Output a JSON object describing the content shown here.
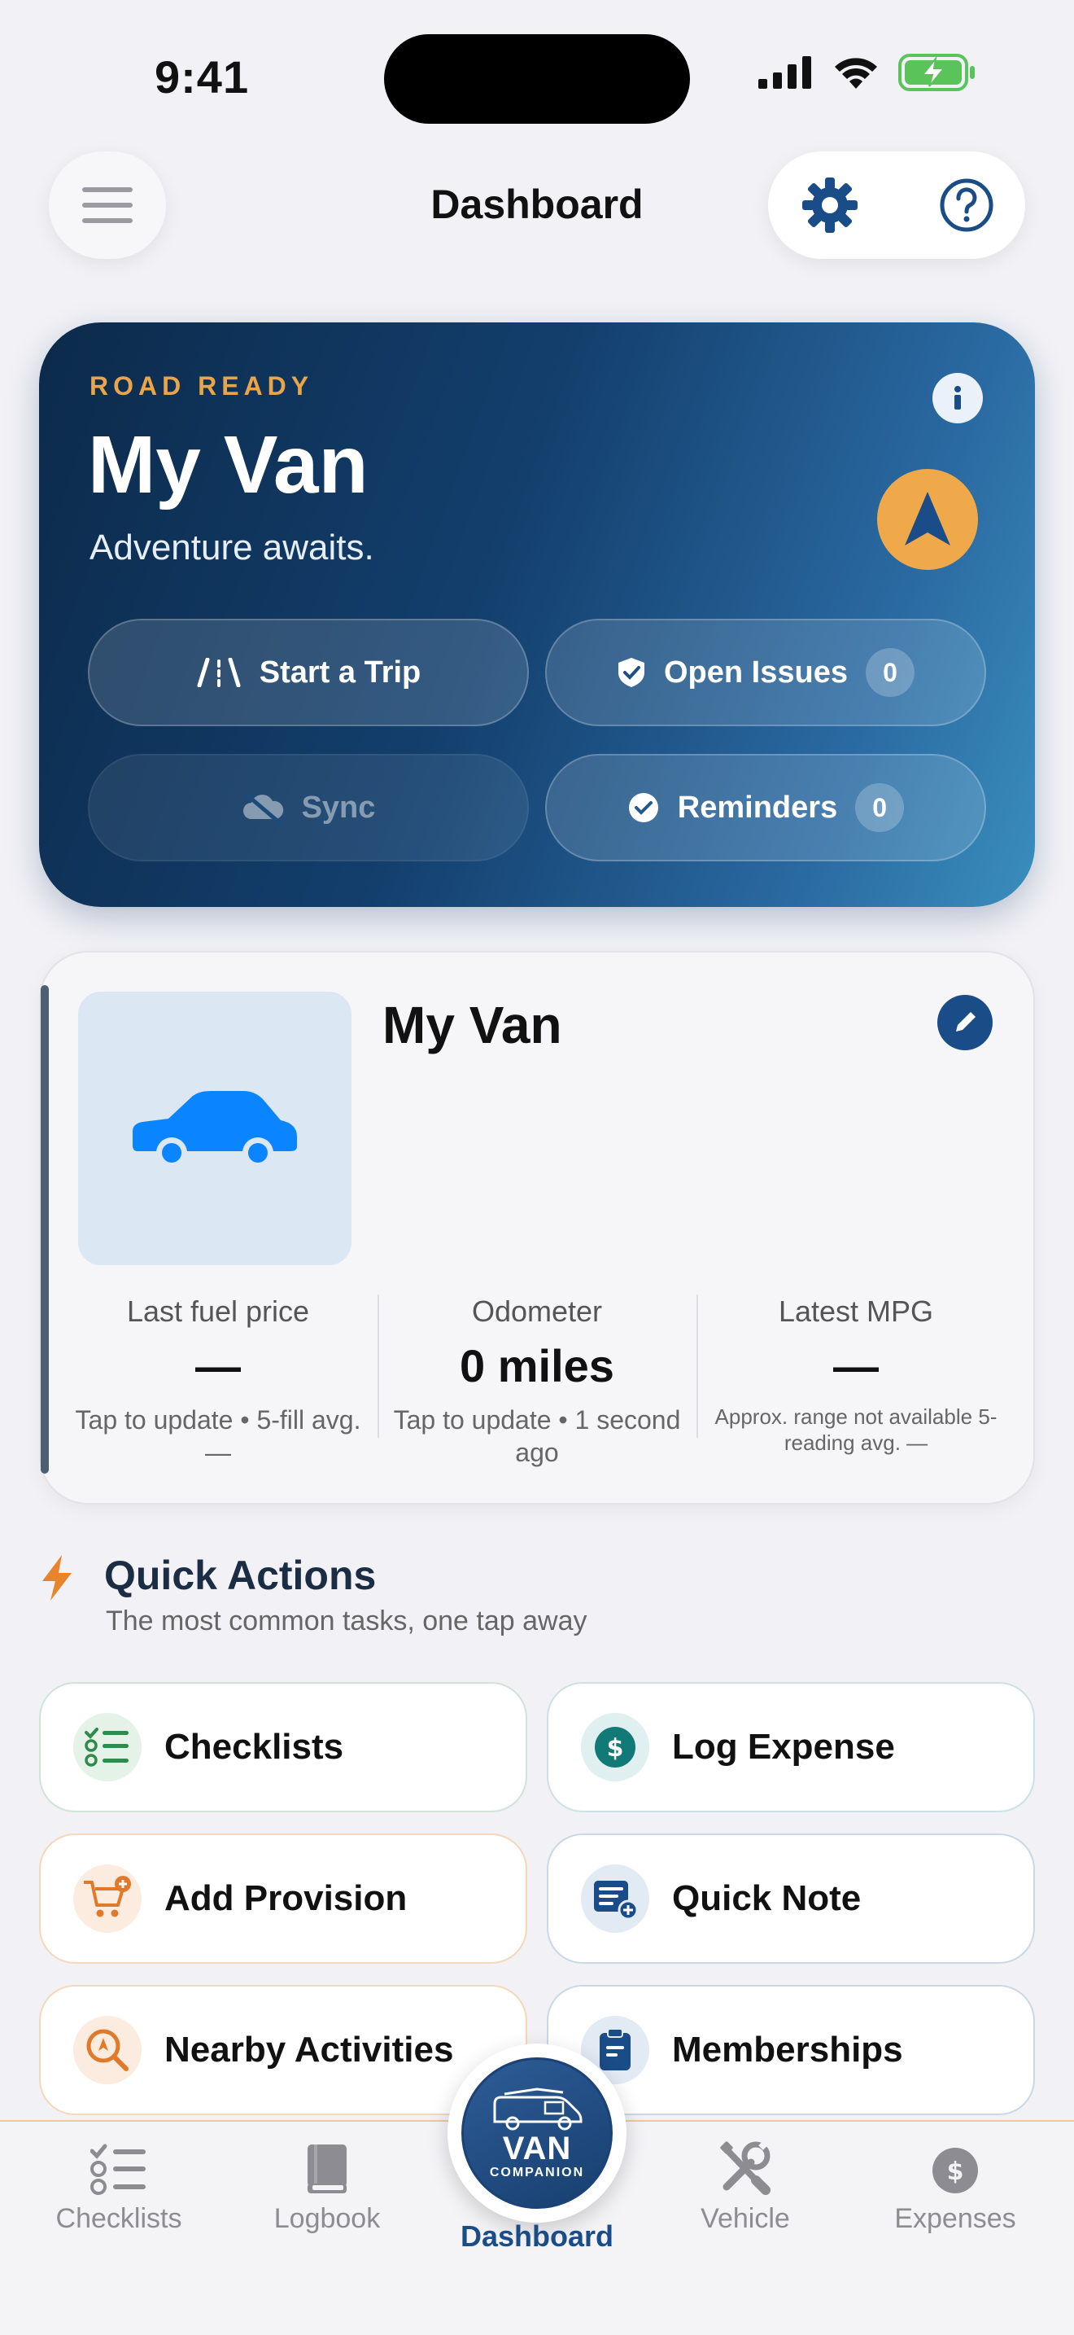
{
  "status": {
    "time": "9:41"
  },
  "header": {
    "title": "Dashboard"
  },
  "hero": {
    "eyebrow": "ROAD READY",
    "title": "My Van",
    "subtitle": "Adventure awaits.",
    "buttons": {
      "start_trip": "Start a Trip",
      "open_issues": "Open Issues",
      "open_issues_count": "0",
      "sync": "Sync",
      "reminders": "Reminders",
      "reminders_count": "0"
    }
  },
  "vehicle": {
    "name": "My Van",
    "stats": [
      {
        "label": "Last fuel price",
        "value": "—",
        "note": "Tap to update • 5-fill avg. —"
      },
      {
        "label": "Odometer",
        "value": "0 miles",
        "note": "Tap to update • 1 second ago"
      },
      {
        "label": "Latest MPG",
        "value": "—",
        "note": "Approx. range not available 5-reading avg. —"
      }
    ]
  },
  "quick_actions": {
    "title": "Quick Actions",
    "subtitle": "The most common tasks, one tap away",
    "items": [
      {
        "label": "Checklists",
        "icon": "checklist-icon"
      },
      {
        "label": "Log Expense",
        "icon": "dollar-icon"
      },
      {
        "label": "Add Provision",
        "icon": "cart-add-icon"
      },
      {
        "label": "Quick Note",
        "icon": "note-add-icon"
      },
      {
        "label": "Nearby Activities",
        "icon": "compass-search-icon"
      },
      {
        "label": "Memberships",
        "icon": "clipboard-icon"
      }
    ]
  },
  "tabbar": {
    "tabs": [
      "Checklists",
      "Logbook",
      "Dashboard",
      "Vehicle",
      "Expenses"
    ],
    "logo_line1": "VAN",
    "logo_line2": "COMPANION"
  },
  "colors": {
    "accent": "#1a4c87",
    "hero_eyebrow": "#e8a54a",
    "nav_orange": "#f0a94a",
    "car_blue": "#0a84ff"
  }
}
